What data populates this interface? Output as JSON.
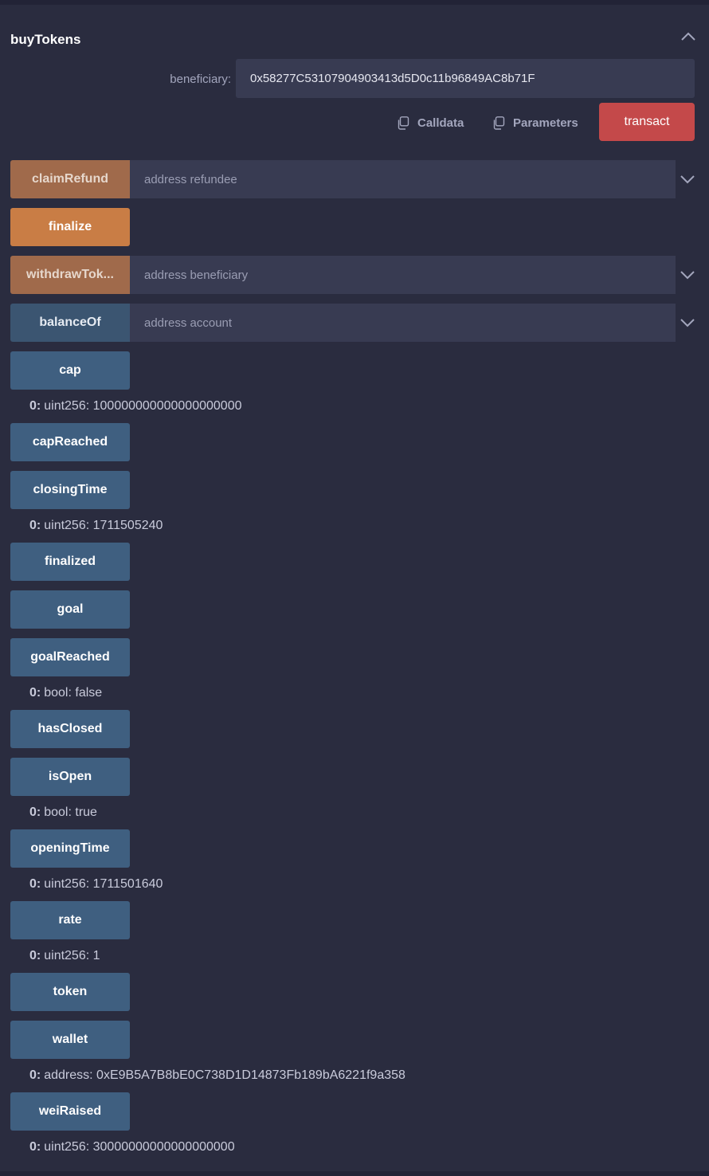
{
  "buy_tokens": {
    "title": "buyTokens",
    "param_label": "beneficiary:",
    "param_value": "0x58277C53107904903413d5D0c11b96849AC8b71F",
    "calldata_label": "Calldata",
    "parameters_label": "Parameters",
    "transact_label": "transact"
  },
  "functions": {
    "claim_refund": {
      "label": "claimRefund",
      "placeholder": "address refundee"
    },
    "finalize": {
      "label": "finalize"
    },
    "withdraw_tokens": {
      "label": "withdrawTok...",
      "placeholder": "address beneficiary"
    },
    "balance_of": {
      "label": "balanceOf",
      "placeholder": "address account"
    },
    "cap": {
      "label": "cap",
      "result_index": "0:",
      "result_value": "uint256: 100000000000000000000"
    },
    "cap_reached": {
      "label": "capReached"
    },
    "closing_time": {
      "label": "closingTime",
      "result_index": "0:",
      "result_value": "uint256: 1711505240"
    },
    "finalized": {
      "label": "finalized"
    },
    "goal": {
      "label": "goal"
    },
    "goal_reached": {
      "label": "goalReached",
      "result_index": "0:",
      "result_value": "bool: false"
    },
    "has_closed": {
      "label": "hasClosed"
    },
    "is_open": {
      "label": "isOpen",
      "result_index": "0:",
      "result_value": "bool: true"
    },
    "opening_time": {
      "label": "openingTime",
      "result_index": "0:",
      "result_value": "uint256: 1711501640"
    },
    "rate": {
      "label": "rate",
      "result_index": "0:",
      "result_value": "uint256: 1"
    },
    "token": {
      "label": "token"
    },
    "wallet": {
      "label": "wallet",
      "result_index": "0:",
      "result_value": "address: 0xE9B5A7B8bE0C738D1D14873Fb189bA6221f9a358"
    },
    "wei_raised": {
      "label": "weiRaised",
      "result_index": "0:",
      "result_value": "uint256: 30000000000000000000"
    }
  },
  "colors": {
    "background": "#2a2c3f",
    "transact": "#c4494a",
    "payable_button": "#c97d45",
    "view_button": "#3f5f80"
  },
  "icons": {
    "collapse": "chevron-up-icon",
    "expand": "chevron-down-icon",
    "copy": "copy-icon"
  }
}
